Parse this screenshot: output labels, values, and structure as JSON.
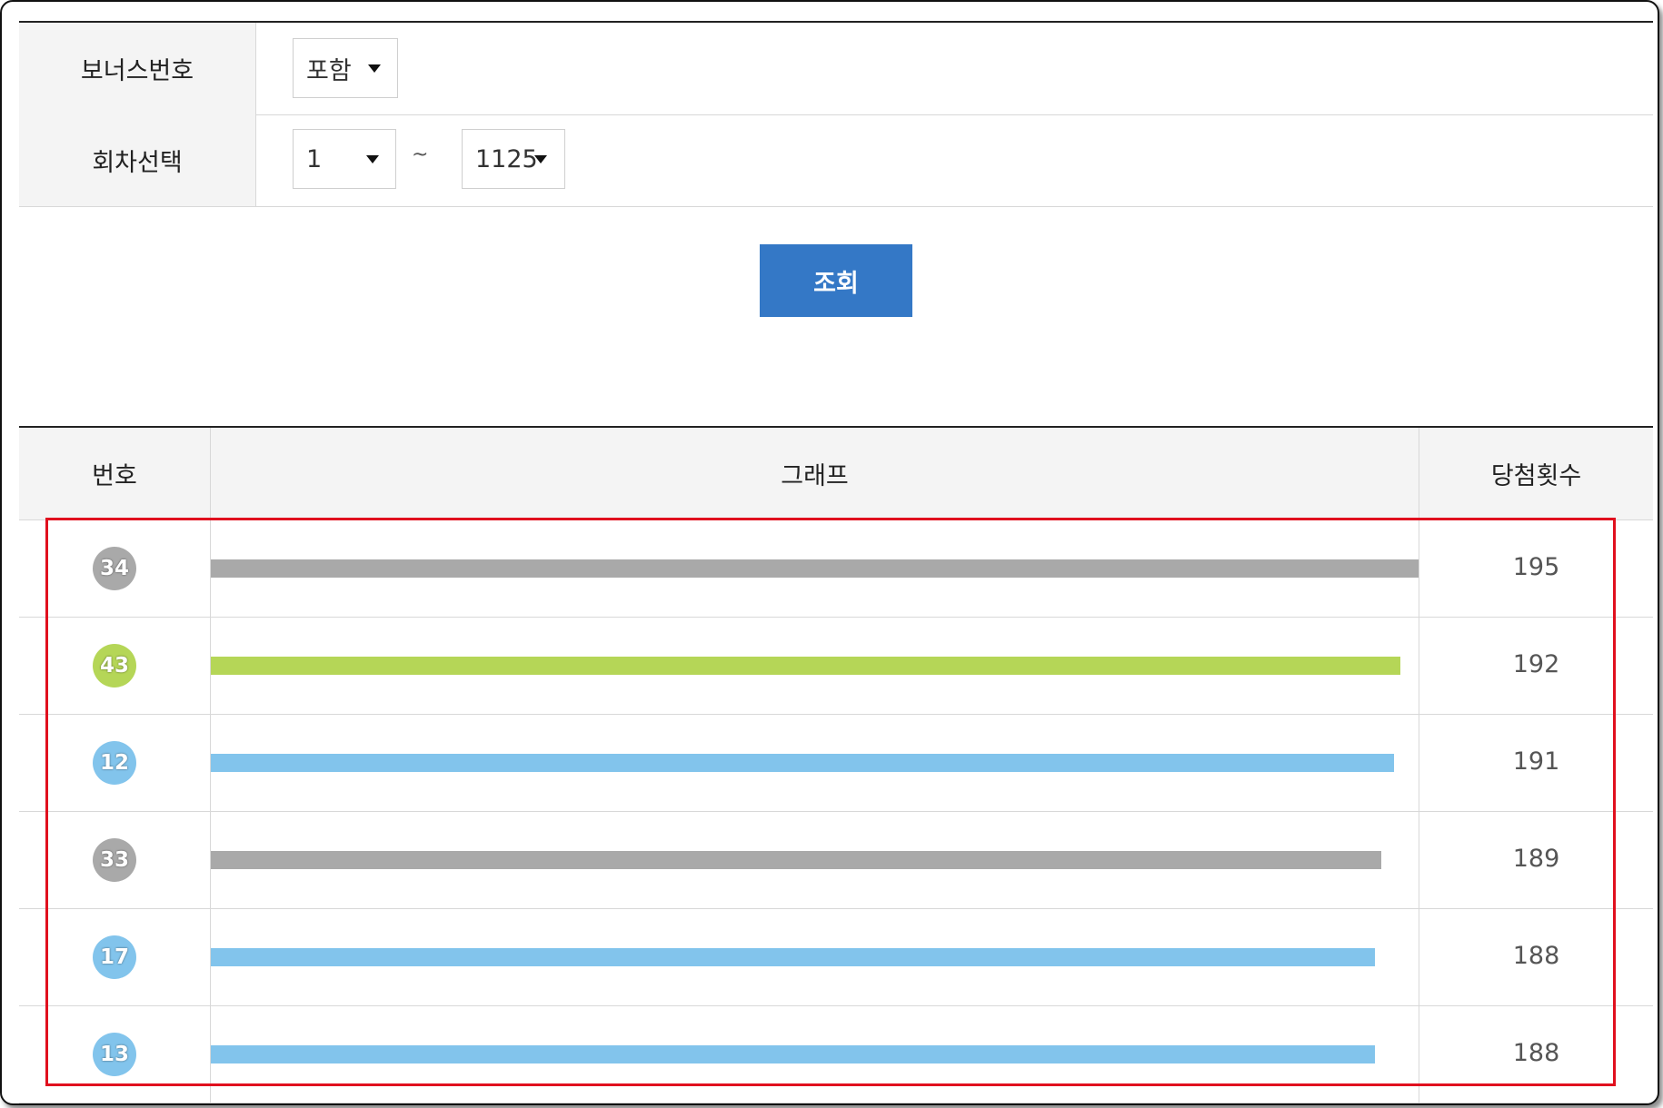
{
  "filter": {
    "bonus_label": "보너스번호",
    "bonus_value": "포함",
    "round_label": "회차선택",
    "round_from": "1",
    "range_sep": "~",
    "round_to": "1125"
  },
  "search_button_label": "조회",
  "table": {
    "headers": {
      "number": "번호",
      "graph": "그래프",
      "count": "당첨횟수"
    },
    "max_count": 195,
    "rows": [
      {
        "number": "34",
        "count": 195,
        "color": "#a9a9a9"
      },
      {
        "number": "43",
        "count": 192,
        "color": "#b5d657"
      },
      {
        "number": "12",
        "count": 191,
        "color": "#82c4ec"
      },
      {
        "number": "33",
        "count": 189,
        "color": "#a9a9a9"
      },
      {
        "number": "17",
        "count": 188,
        "color": "#82c4ec"
      },
      {
        "number": "13",
        "count": 188,
        "color": "#82c4ec"
      }
    ]
  }
}
